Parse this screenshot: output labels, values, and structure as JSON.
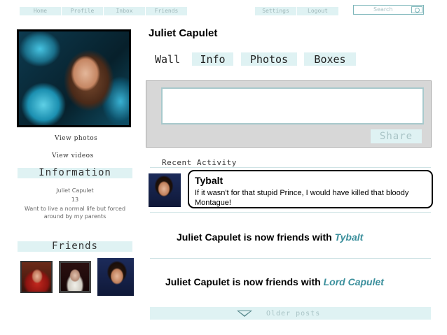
{
  "nav": {
    "items": [
      "Home",
      "Profile",
      "Inbox",
      "Friends"
    ],
    "right_items": [
      "Settings",
      "Logout"
    ]
  },
  "search": {
    "placeholder": "Search"
  },
  "sidebar": {
    "view_photos": "View photos",
    "view_videos": "View videos",
    "information_heading": "Information",
    "info": {
      "name": "Juliet Capulet",
      "age": "13",
      "bio": "Want to live a normal life but forced around by my parents"
    },
    "friends_heading": "Friends"
  },
  "profile": {
    "name": "Juliet Capulet"
  },
  "tabs": [
    "Wall",
    "Info",
    "Photos",
    "Boxes"
  ],
  "composer": {
    "share_label": "Share"
  },
  "activity": {
    "heading": "Recent Activity",
    "post": {
      "author": "Tybalt",
      "message": "If it wasn't for that stupid Prince, I would have killed that bloody Montague!"
    },
    "friend_events": [
      {
        "text": "Juliet Capulet is now friends with ",
        "friend": "Tybalt"
      },
      {
        "text": "Juliet Capulet is now friends with ",
        "friend": "Lord Capulet"
      }
    ],
    "older_posts": "Older posts"
  },
  "colors": {
    "accent_bg": "#dff2f3",
    "link": "#3b8f9c",
    "border": "#7fb7bb"
  }
}
